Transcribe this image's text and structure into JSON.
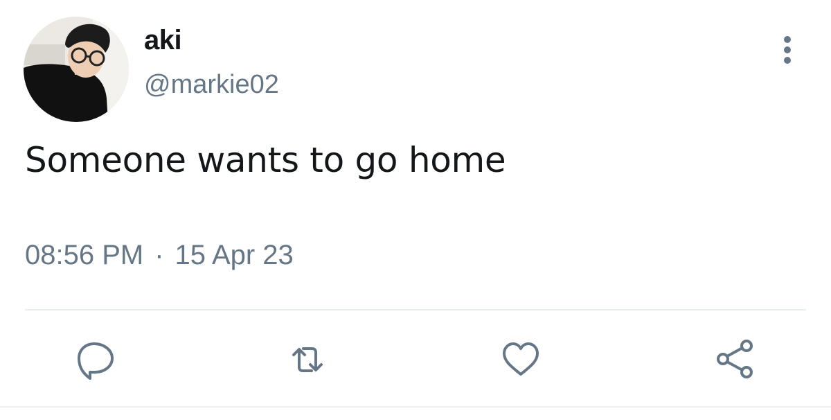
{
  "user": {
    "display_name": "aki",
    "handle": "@markie02"
  },
  "tweet": {
    "text": "Someone wants to go home",
    "time": "08:56 PM",
    "separator": "·",
    "date": "15 Apr 23"
  },
  "actions": [
    {
      "icon": "reply-icon"
    },
    {
      "icon": "retweet-icon"
    },
    {
      "icon": "like-icon"
    },
    {
      "icon": "share-icon"
    }
  ],
  "colors": {
    "text": "#14171a",
    "secondary": "#657786",
    "icon": "#657786",
    "divider": "#e6ecf0"
  }
}
